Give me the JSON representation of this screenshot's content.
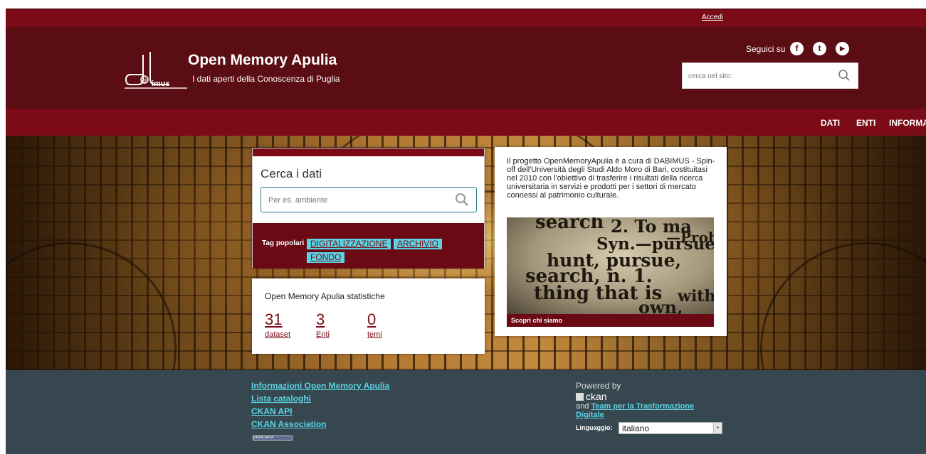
{
  "account": {
    "login_label": "Accedi"
  },
  "header": {
    "title": "Open Memory Apulia",
    "logo_text": "imus",
    "subtitle": "I dati aperti della Conoscenza di Puglia",
    "follow_label": "Seguici su",
    "social": [
      {
        "icon": "facebook-icon",
        "glyph": "f"
      },
      {
        "icon": "twitter-icon",
        "glyph": "t"
      },
      {
        "icon": "youtube-icon",
        "glyph": "▶"
      }
    ],
    "site_search_placeholder": "cerca nel sito:"
  },
  "nav": {
    "items": [
      "DATI",
      "ENTI",
      "INFORMA"
    ]
  },
  "search_panel": {
    "title": "Cerca i dati",
    "placeholder": "Per es. ambiente",
    "tags_label": "Tag popolari",
    "tags": [
      "DIGITALIZZAZIONE",
      "ARCHIVIO",
      "FONDO"
    ]
  },
  "stats": {
    "title": "Open Memory Apulia statistiche",
    "items": [
      {
        "count": "31",
        "label": "dataset"
      },
      {
        "count": "3",
        "label": "Enti"
      },
      {
        "count": "0",
        "label": "temi"
      }
    ]
  },
  "about": {
    "text": "Il progetto OpenMemoryApulia è a cura di DABIMUS - Spin-off dell'Università degli Studi Aldo Moro di Bari, costituitasi nel 2010 con l'obiettivo di trasferire i risultati della ricerca universitaria in servizi e prodotti per i settori di mercato connessi al patrimonio culturale.",
    "image_words": [
      "search",
      "2. To ma",
      "—Probe",
      "Syn.—pursue,",
      "hunt, pursue,",
      "search, n. 1.",
      "thing that is",
      "with",
      "own,"
    ],
    "caption": "Scopri chi siamo"
  },
  "footer": {
    "links": [
      "Informazioni Open Memory Apulia",
      "Lista cataloghi",
      "CKAN API",
      "CKAN Association"
    ],
    "badge_text": "OPEN DATA",
    "powered_by": "Powered by",
    "ckan": "ckan",
    "and_text": "and",
    "team_link": "Team per la Trasformazione Digitale",
    "language_label": "Linguaggio:",
    "language_value": "italiano"
  },
  "colors": {
    "brand": "#7a0b17",
    "dark_brand": "#5a0d12",
    "accent": "#5ad3e3",
    "footer_bg": "#37474f"
  }
}
